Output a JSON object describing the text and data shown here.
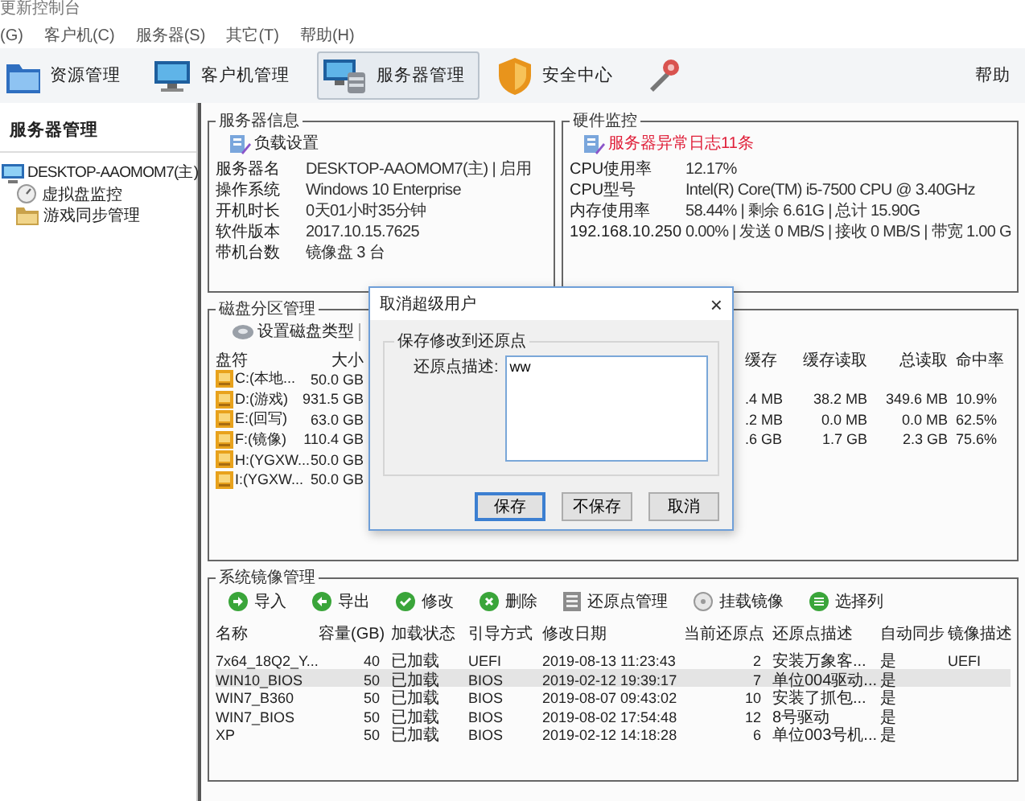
{
  "window": {
    "title": "更新控制台"
  },
  "menu": [
    {
      "label": "(G)"
    },
    {
      "label": "客户机(C)"
    },
    {
      "label": "服务器(S)"
    },
    {
      "label": "其它(T)"
    },
    {
      "label": "帮助(H)"
    }
  ],
  "toolbar": [
    {
      "label": "资源管理",
      "selected": false
    },
    {
      "label": "客户机管理",
      "selected": false
    },
    {
      "label": "服务器管理",
      "selected": true
    },
    {
      "label": "安全中心",
      "selected": false
    },
    {
      "selected": false
    },
    {
      "label": "帮助",
      "selected": false
    }
  ],
  "sidebar": {
    "title": "服务器管理",
    "tree": [
      {
        "label": "DESKTOP-AAOMOM7(主)",
        "children": [
          {
            "label": "虚拟盘监控"
          },
          {
            "label": "游戏同步管理"
          }
        ]
      }
    ]
  },
  "server_info": {
    "title": "服务器信息",
    "link": "负载设置",
    "rows": [
      {
        "label": "服务器名",
        "value": "DESKTOP-AAOMOM7(主) | 启用"
      },
      {
        "label": "操作系统",
        "value": "Windows 10 Enterprise"
      },
      {
        "label": "开机时长",
        "value": "0天01小时35分钟"
      },
      {
        "label": "软件版本",
        "value": "2017.10.15.7625"
      },
      {
        "label": "带机台数",
        "value": "镜像盘 3 台"
      }
    ]
  },
  "hardware": {
    "title": "硬件监控",
    "alert": "服务器异常日志11条",
    "rows": [
      {
        "label": "CPU使用率",
        "value": "12.17%"
      },
      {
        "label": "CPU型号",
        "value": "Intel(R) Core(TM) i5-7500 CPU @ 3.40GHz"
      },
      {
        "label": "内存使用率",
        "value": "58.44% | 剩余 6.61G | 总计 15.90G"
      },
      {
        "label": "192.168.10.250",
        "value": "0.00% | 发送 0 MB/S | 接收 0 MB/S | 带宽 1.00 G"
      }
    ]
  },
  "disk": {
    "title": "磁盘分区管理",
    "tool": "设置磁盘类型",
    "columns": [
      "盘符",
      "大小",
      "缓存",
      "缓存读取",
      "总读取",
      "命中率"
    ],
    "rows": [
      {
        "cells": [
          "C:(本地...",
          "50.0 GB"
        ]
      },
      {
        "cells": [
          "D:(游戏)",
          "931.5 GB",
          ".4 MB",
          "38.2 MB",
          "349.6 MB",
          "10.9%"
        ]
      },
      {
        "cells": [
          "E:(回写)",
          "63.0 GB",
          ".2 MB",
          "0.0 MB",
          "0.0 MB",
          "62.5%"
        ]
      },
      {
        "cells": [
          "F:(镜像)",
          "110.4 GB",
          ".6 GB",
          "1.7 GB",
          "2.3 GB",
          "75.6%"
        ]
      },
      {
        "cells": [
          "H:(YGXW...",
          "50.0 GB"
        ]
      },
      {
        "cells": [
          "I:(YGXW...",
          "50.0 GB"
        ]
      }
    ]
  },
  "dialog": {
    "title": "取消超级用户",
    "close": "×",
    "group": "保存修改到还原点",
    "label": "还原点描述:",
    "value": "ww",
    "buttons": [
      {
        "label": "保存",
        "default": true
      },
      {
        "label": "不保存",
        "default": false
      },
      {
        "label": "取消",
        "default": false
      }
    ]
  },
  "images": {
    "title": "系统镜像管理",
    "tools": [
      {
        "label": "导入"
      },
      {
        "label": "导出"
      },
      {
        "label": "修改"
      },
      {
        "label": "删除"
      },
      {
        "label": "还原点管理"
      },
      {
        "label": "挂载镜像"
      },
      {
        "label": "选择列"
      }
    ],
    "columns": [
      "名称",
      "容量(GB)",
      "加载状态",
      "引导方式",
      "修改日期",
      "当前还原点",
      "还原点描述",
      "自动同步",
      "镜像描述"
    ],
    "rows": [
      {
        "selected": false,
        "cells": [
          "7x64_18Q2_Y...",
          "40",
          "已加载",
          "UEFI",
          "2019-08-13 11:23:43",
          "2",
          "安装万象客...",
          "是",
          "UEFI"
        ]
      },
      {
        "selected": true,
        "cells": [
          "WIN10_BIOS",
          "50",
          "已加载",
          "BIOS",
          "2019-02-12 19:39:17",
          "7",
          "单位004驱动...",
          "是"
        ]
      },
      {
        "selected": false,
        "cells": [
          "WIN7_B360",
          "50",
          "已加载",
          "BIOS",
          "2019-08-07 09:43:02",
          "10",
          "安装了抓包...",
          "是"
        ]
      },
      {
        "selected": false,
        "cells": [
          "WIN7_BIOS",
          "50",
          "已加载",
          "BIOS",
          "2019-08-02 17:54:48",
          "12",
          "8号驱动",
          "是"
        ]
      },
      {
        "selected": false,
        "cells": [
          "XP",
          "50",
          "已加载",
          "BIOS",
          "2019-02-12 14:18:28",
          "6",
          "单位003号机...",
          "是"
        ]
      }
    ]
  }
}
